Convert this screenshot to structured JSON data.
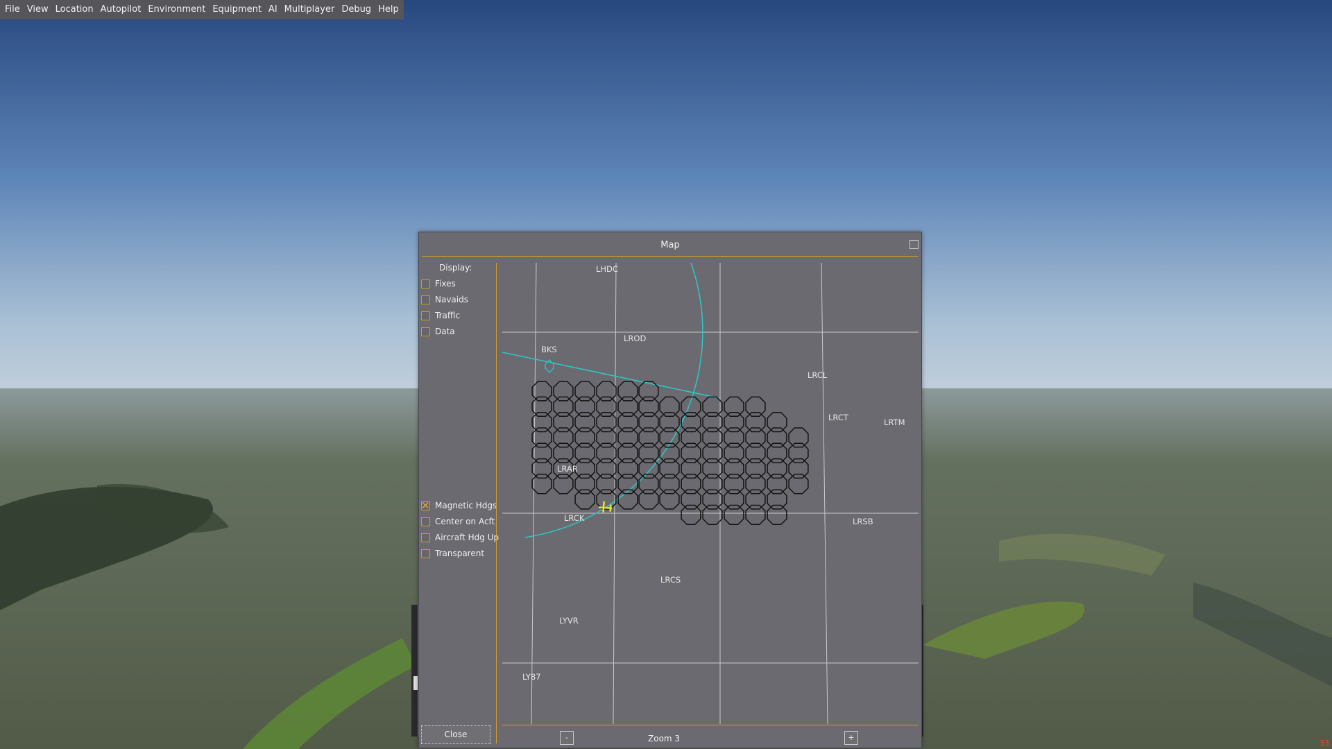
{
  "menubar": {
    "items": [
      "File",
      "View",
      "Location",
      "Autopilot",
      "Environment",
      "Equipment",
      "AI",
      "Multiplayer",
      "Debug",
      "Help"
    ]
  },
  "dialog": {
    "title": "Map",
    "display_label": "Display:",
    "options_top": [
      {
        "label": "Fixes",
        "checked": false
      },
      {
        "label": "Navaids",
        "checked": false
      },
      {
        "label": "Traffic",
        "checked": false
      },
      {
        "label": "Data",
        "checked": false
      }
    ],
    "options_bottom": [
      {
        "label": "Magnetic Hdgs",
        "checked": true
      },
      {
        "label": "Center on Acft",
        "checked": false
      },
      {
        "label": "Aircraft Hdg Up",
        "checked": false
      },
      {
        "label": "Transparent",
        "checked": false
      }
    ],
    "close_label": "Close",
    "zoom_label": "Zoom 3",
    "zoom_minus": "-",
    "zoom_plus": "+"
  },
  "map": {
    "airports": [
      "LHDC",
      "LROD",
      "BKS",
      "LRCL",
      "LRCT",
      "LRTM",
      "LRAR",
      "LRCK",
      "LRSB",
      "LRCS",
      "LYVR",
      "LY87"
    ],
    "navaid": "BKS",
    "colors": {
      "background": "#6b6a70",
      "grid": "#c9c9cc",
      "range_ring": "#2ec4c4",
      "aircraft": "#e8e030",
      "symbols": "#141414",
      "accent": "#d49b2e"
    }
  },
  "status": {
    "fps": "33"
  },
  "colors": {
    "sky_top": "#2b4c86",
    "sky_horizon": "#b4c8d8",
    "ground": "#5a6652"
  }
}
